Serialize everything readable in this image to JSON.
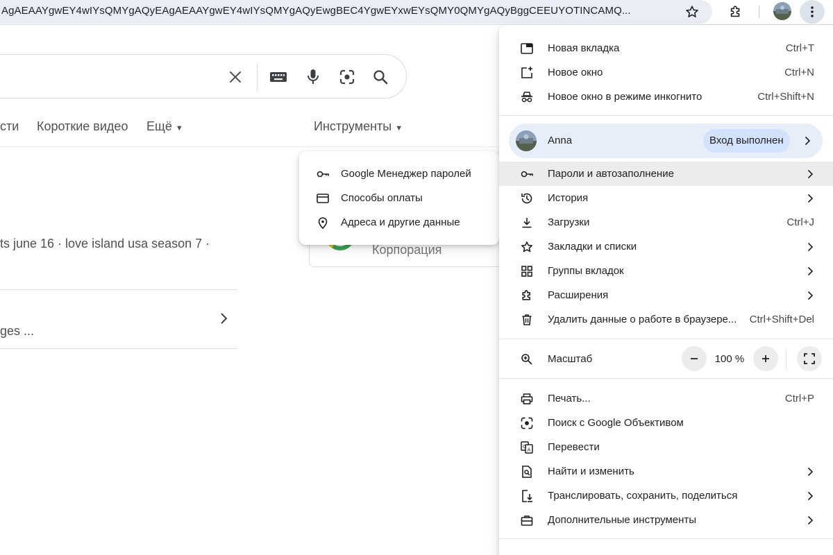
{
  "toolbar": {
    "url": "AgAEAAYgwEY4wIYsQMYgAQyEAgAEAAYgwEY4wIYsQMYgAQyEwgBEC4YgwEYxwEYsQMY0QMYgAQyBggCEEUYOTINCAMQ...",
    "icons": [
      "star-icon",
      "extensions-icon",
      "profile-avatar",
      "more-vert-icon"
    ]
  },
  "search": {
    "tabs": [
      {
        "label": "сти"
      },
      {
        "label": "Короткие видео"
      },
      {
        "label": "Ещё"
      },
      {
        "label": "Инструменты"
      }
    ],
    "snippet": "ts june 16 · love island usa season 7 ·",
    "result_text": "ges ...",
    "kp_name": "Корпорация"
  },
  "submenu": {
    "items": [
      {
        "label": "Google Менеджер паролей",
        "icon": "key-icon"
      },
      {
        "label": "Способы оплаты",
        "icon": "credit-card-icon"
      },
      {
        "label": "Адреса и другие данные",
        "icon": "location-pin-icon"
      }
    ]
  },
  "menu": {
    "group1": [
      {
        "label": "Новая вкладка",
        "shortcut": "Ctrl+T",
        "icon": "new-tab-icon"
      },
      {
        "label": "Новое окно",
        "shortcut": "Ctrl+N",
        "icon": "new-window-icon"
      },
      {
        "label": "Новое окно в режиме инкогнито",
        "shortcut": "Ctrl+Shift+N",
        "icon": "incognito-icon"
      }
    ],
    "profile": {
      "name": "Anna",
      "status": "Вход выполнен"
    },
    "group2": [
      {
        "label": "Пароли и автозаполнение",
        "shortcut": "",
        "icon": "key-icon",
        "submenu": true
      },
      {
        "label": "История",
        "shortcut": "",
        "icon": "history-icon",
        "submenu": true
      },
      {
        "label": "Загрузки",
        "shortcut": "Ctrl+J",
        "icon": "download-icon",
        "submenu": false
      },
      {
        "label": "Закладки и списки",
        "shortcut": "",
        "icon": "star-icon",
        "submenu": true
      },
      {
        "label": "Группы вкладок",
        "shortcut": "",
        "icon": "tab-groups-icon",
        "submenu": true
      },
      {
        "label": "Расширения",
        "shortcut": "",
        "icon": "extensions-icon",
        "submenu": true
      },
      {
        "label": "Удалить данные о работе в браузере...",
        "shortcut": "Ctrl+Shift+Del",
        "icon": "trash-icon",
        "submenu": false
      }
    ],
    "zoom": {
      "label": "Масштаб",
      "value": "100 %"
    },
    "group3": [
      {
        "label": "Печать...",
        "shortcut": "Ctrl+P",
        "icon": "print-icon",
        "submenu": false
      },
      {
        "label": "Поиск с Google Объективом",
        "shortcut": "",
        "icon": "google-lens-icon",
        "submenu": false
      },
      {
        "label": "Перевести",
        "shortcut": "",
        "icon": "translate-icon",
        "submenu": false
      },
      {
        "label": "Найти и изменить",
        "shortcut": "",
        "icon": "find-icon",
        "submenu": true
      },
      {
        "label": "Транслировать, сохранить, поделиться",
        "shortcut": "",
        "icon": "cast-save-share-icon",
        "submenu": true
      },
      {
        "label": "Дополнительные инструменты",
        "shortcut": "",
        "icon": "toolbox-icon",
        "submenu": true
      }
    ]
  }
}
